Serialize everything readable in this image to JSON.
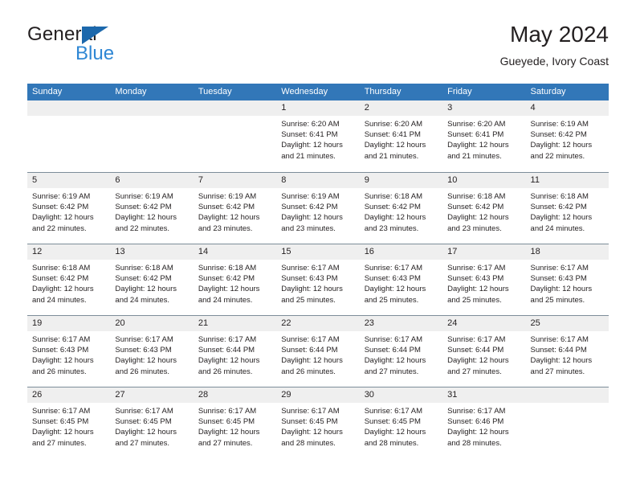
{
  "logo": {
    "word_one": "General",
    "word_two": "Blue",
    "triangle_icon": "blue-triangle-icon",
    "accent_dark": "#1c68ac",
    "accent_light": "#2f87d4"
  },
  "header": {
    "title": "May 2024",
    "subtitle": "Gueyede, Ivory Coast"
  },
  "theme": {
    "header_blue": "#3277b8",
    "day_band_gray": "#efefef",
    "row_divider": "#7d8d99",
    "text": "#231f20"
  },
  "weekdays": [
    "Sunday",
    "Monday",
    "Tuesday",
    "Wednesday",
    "Thursday",
    "Friday",
    "Saturday"
  ],
  "weeks": [
    [
      {
        "day": "",
        "sunrise": "",
        "sunset": "",
        "daylight_line1": "",
        "daylight_line2": ""
      },
      {
        "day": "",
        "sunrise": "",
        "sunset": "",
        "daylight_line1": "",
        "daylight_line2": ""
      },
      {
        "day": "",
        "sunrise": "",
        "sunset": "",
        "daylight_line1": "",
        "daylight_line2": ""
      },
      {
        "day": "1",
        "sunrise": "Sunrise: 6:20 AM",
        "sunset": "Sunset: 6:41 PM",
        "daylight_line1": "Daylight: 12 hours",
        "daylight_line2": "and 21 minutes."
      },
      {
        "day": "2",
        "sunrise": "Sunrise: 6:20 AM",
        "sunset": "Sunset: 6:41 PM",
        "daylight_line1": "Daylight: 12 hours",
        "daylight_line2": "and 21 minutes."
      },
      {
        "day": "3",
        "sunrise": "Sunrise: 6:20 AM",
        "sunset": "Sunset: 6:41 PM",
        "daylight_line1": "Daylight: 12 hours",
        "daylight_line2": "and 21 minutes."
      },
      {
        "day": "4",
        "sunrise": "Sunrise: 6:19 AM",
        "sunset": "Sunset: 6:42 PM",
        "daylight_line1": "Daylight: 12 hours",
        "daylight_line2": "and 22 minutes."
      }
    ],
    [
      {
        "day": "5",
        "sunrise": "Sunrise: 6:19 AM",
        "sunset": "Sunset: 6:42 PM",
        "daylight_line1": "Daylight: 12 hours",
        "daylight_line2": "and 22 minutes."
      },
      {
        "day": "6",
        "sunrise": "Sunrise: 6:19 AM",
        "sunset": "Sunset: 6:42 PM",
        "daylight_line1": "Daylight: 12 hours",
        "daylight_line2": "and 22 minutes."
      },
      {
        "day": "7",
        "sunrise": "Sunrise: 6:19 AM",
        "sunset": "Sunset: 6:42 PM",
        "daylight_line1": "Daylight: 12 hours",
        "daylight_line2": "and 23 minutes."
      },
      {
        "day": "8",
        "sunrise": "Sunrise: 6:19 AM",
        "sunset": "Sunset: 6:42 PM",
        "daylight_line1": "Daylight: 12 hours",
        "daylight_line2": "and 23 minutes."
      },
      {
        "day": "9",
        "sunrise": "Sunrise: 6:18 AM",
        "sunset": "Sunset: 6:42 PM",
        "daylight_line1": "Daylight: 12 hours",
        "daylight_line2": "and 23 minutes."
      },
      {
        "day": "10",
        "sunrise": "Sunrise: 6:18 AM",
        "sunset": "Sunset: 6:42 PM",
        "daylight_line1": "Daylight: 12 hours",
        "daylight_line2": "and 23 minutes."
      },
      {
        "day": "11",
        "sunrise": "Sunrise: 6:18 AM",
        "sunset": "Sunset: 6:42 PM",
        "daylight_line1": "Daylight: 12 hours",
        "daylight_line2": "and 24 minutes."
      }
    ],
    [
      {
        "day": "12",
        "sunrise": "Sunrise: 6:18 AM",
        "sunset": "Sunset: 6:42 PM",
        "daylight_line1": "Daylight: 12 hours",
        "daylight_line2": "and 24 minutes."
      },
      {
        "day": "13",
        "sunrise": "Sunrise: 6:18 AM",
        "sunset": "Sunset: 6:42 PM",
        "daylight_line1": "Daylight: 12 hours",
        "daylight_line2": "and 24 minutes."
      },
      {
        "day": "14",
        "sunrise": "Sunrise: 6:18 AM",
        "sunset": "Sunset: 6:42 PM",
        "daylight_line1": "Daylight: 12 hours",
        "daylight_line2": "and 24 minutes."
      },
      {
        "day": "15",
        "sunrise": "Sunrise: 6:17 AM",
        "sunset": "Sunset: 6:43 PM",
        "daylight_line1": "Daylight: 12 hours",
        "daylight_line2": "and 25 minutes."
      },
      {
        "day": "16",
        "sunrise": "Sunrise: 6:17 AM",
        "sunset": "Sunset: 6:43 PM",
        "daylight_line1": "Daylight: 12 hours",
        "daylight_line2": "and 25 minutes."
      },
      {
        "day": "17",
        "sunrise": "Sunrise: 6:17 AM",
        "sunset": "Sunset: 6:43 PM",
        "daylight_line1": "Daylight: 12 hours",
        "daylight_line2": "and 25 minutes."
      },
      {
        "day": "18",
        "sunrise": "Sunrise: 6:17 AM",
        "sunset": "Sunset: 6:43 PM",
        "daylight_line1": "Daylight: 12 hours",
        "daylight_line2": "and 25 minutes."
      }
    ],
    [
      {
        "day": "19",
        "sunrise": "Sunrise: 6:17 AM",
        "sunset": "Sunset: 6:43 PM",
        "daylight_line1": "Daylight: 12 hours",
        "daylight_line2": "and 26 minutes."
      },
      {
        "day": "20",
        "sunrise": "Sunrise: 6:17 AM",
        "sunset": "Sunset: 6:43 PM",
        "daylight_line1": "Daylight: 12 hours",
        "daylight_line2": "and 26 minutes."
      },
      {
        "day": "21",
        "sunrise": "Sunrise: 6:17 AM",
        "sunset": "Sunset: 6:44 PM",
        "daylight_line1": "Daylight: 12 hours",
        "daylight_line2": "and 26 minutes."
      },
      {
        "day": "22",
        "sunrise": "Sunrise: 6:17 AM",
        "sunset": "Sunset: 6:44 PM",
        "daylight_line1": "Daylight: 12 hours",
        "daylight_line2": "and 26 minutes."
      },
      {
        "day": "23",
        "sunrise": "Sunrise: 6:17 AM",
        "sunset": "Sunset: 6:44 PM",
        "daylight_line1": "Daylight: 12 hours",
        "daylight_line2": "and 27 minutes."
      },
      {
        "day": "24",
        "sunrise": "Sunrise: 6:17 AM",
        "sunset": "Sunset: 6:44 PM",
        "daylight_line1": "Daylight: 12 hours",
        "daylight_line2": "and 27 minutes."
      },
      {
        "day": "25",
        "sunrise": "Sunrise: 6:17 AM",
        "sunset": "Sunset: 6:44 PM",
        "daylight_line1": "Daylight: 12 hours",
        "daylight_line2": "and 27 minutes."
      }
    ],
    [
      {
        "day": "26",
        "sunrise": "Sunrise: 6:17 AM",
        "sunset": "Sunset: 6:45 PM",
        "daylight_line1": "Daylight: 12 hours",
        "daylight_line2": "and 27 minutes."
      },
      {
        "day": "27",
        "sunrise": "Sunrise: 6:17 AM",
        "sunset": "Sunset: 6:45 PM",
        "daylight_line1": "Daylight: 12 hours",
        "daylight_line2": "and 27 minutes."
      },
      {
        "day": "28",
        "sunrise": "Sunrise: 6:17 AM",
        "sunset": "Sunset: 6:45 PM",
        "daylight_line1": "Daylight: 12 hours",
        "daylight_line2": "and 27 minutes."
      },
      {
        "day": "29",
        "sunrise": "Sunrise: 6:17 AM",
        "sunset": "Sunset: 6:45 PM",
        "daylight_line1": "Daylight: 12 hours",
        "daylight_line2": "and 28 minutes."
      },
      {
        "day": "30",
        "sunrise": "Sunrise: 6:17 AM",
        "sunset": "Sunset: 6:45 PM",
        "daylight_line1": "Daylight: 12 hours",
        "daylight_line2": "and 28 minutes."
      },
      {
        "day": "31",
        "sunrise": "Sunrise: 6:17 AM",
        "sunset": "Sunset: 6:46 PM",
        "daylight_line1": "Daylight: 12 hours",
        "daylight_line2": "and 28 minutes."
      },
      {
        "day": "",
        "sunrise": "",
        "sunset": "",
        "daylight_line1": "",
        "daylight_line2": ""
      }
    ]
  ]
}
